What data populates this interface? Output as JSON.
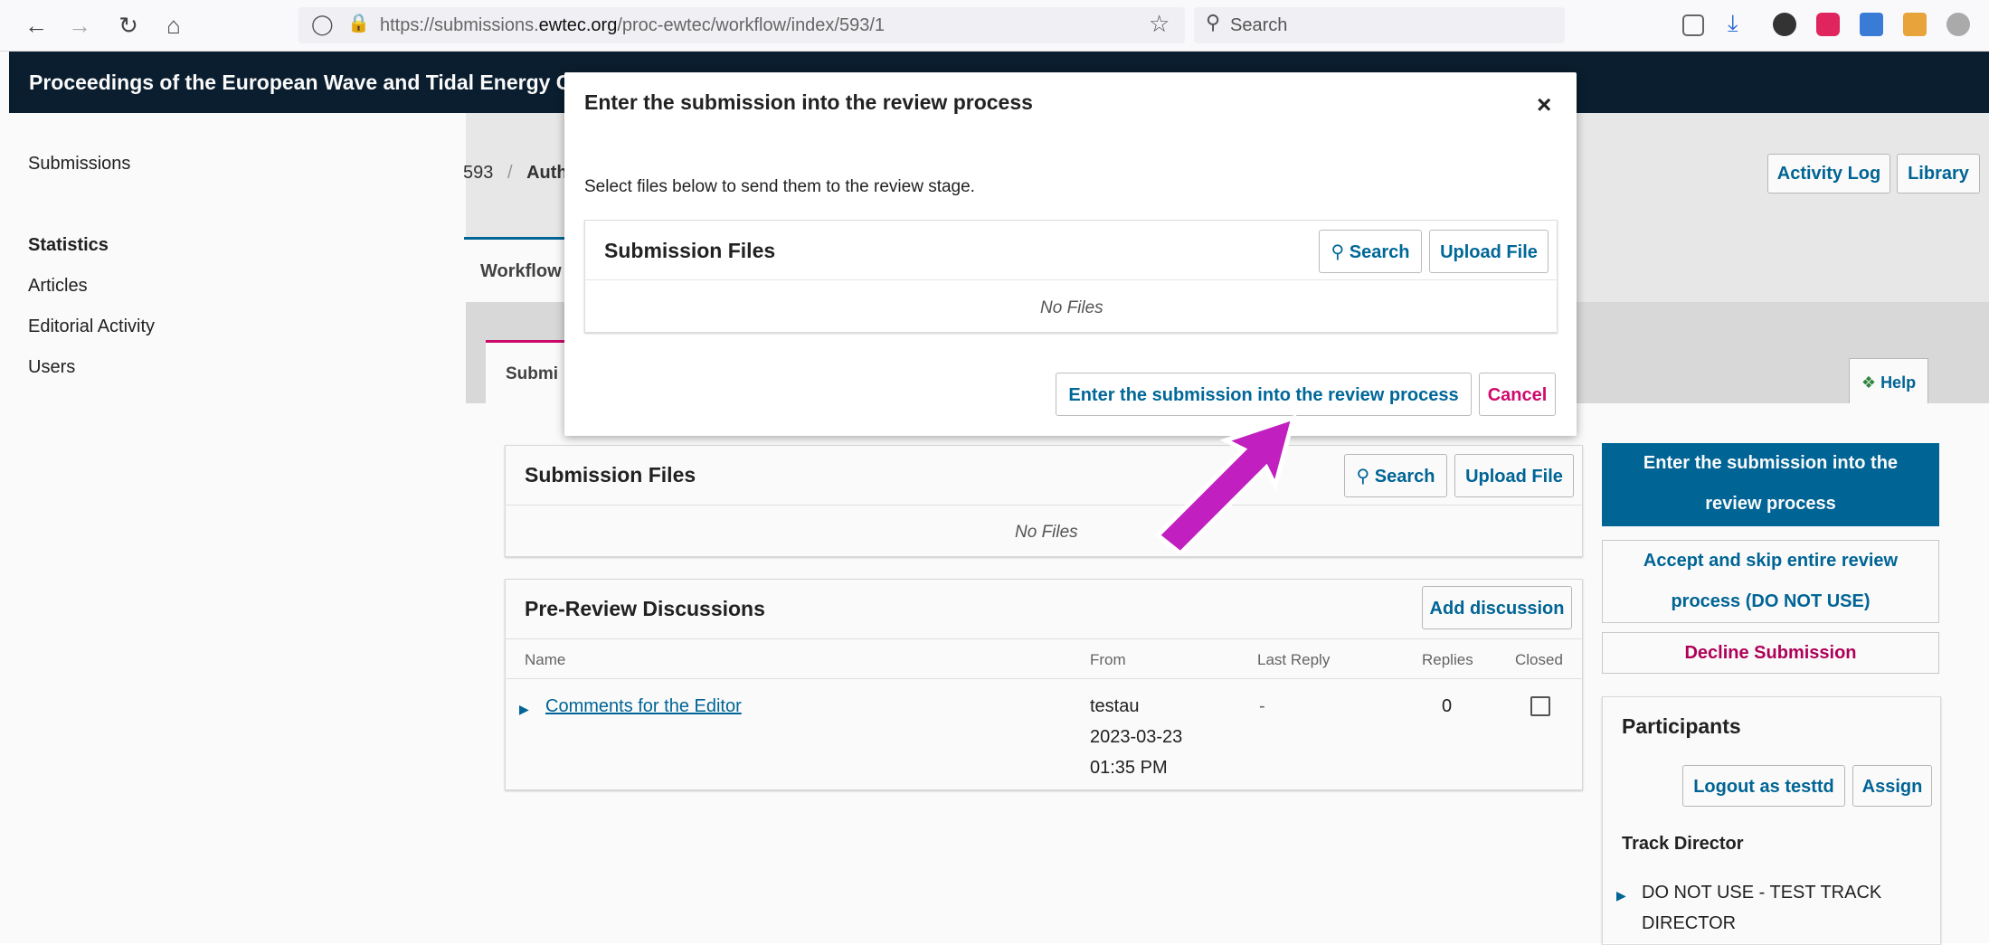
{
  "browser": {
    "url_prefix": "https://submissions.",
    "url_domain": "ewtec.org",
    "url_path": "/proc-ewtec/workflow/index/593/1",
    "search_placeholder": "Search"
  },
  "site": {
    "title": "Proceedings of the European Wave and Tidal Energy C"
  },
  "left_nav": {
    "submissions": "Submissions",
    "statistics": "Statistics",
    "articles": "Articles",
    "editorial_activity": "Editorial Activity",
    "users": "Users"
  },
  "header": {
    "breadcrumb_id": "593",
    "breadcrumb_sep": "/",
    "breadcrumb_author": "Auth",
    "activity_log": "Activity Log",
    "library": "Library"
  },
  "tabs": {
    "workflow": "Workflow",
    "submission": "Submi",
    "help": "Help"
  },
  "submission_files": {
    "title": "Submission Files",
    "search": "Search",
    "upload": "Upload File",
    "empty": "No Files"
  },
  "discussions": {
    "title": "Pre-Review Discussions",
    "add": "Add discussion",
    "columns": [
      "Name",
      "From",
      "Last Reply",
      "Replies",
      "Closed"
    ],
    "rows": [
      {
        "name": "Comments for the Editor",
        "from_user": "testau",
        "from_date": "2023-03-23",
        "from_time": "01:35 PM",
        "last_reply": "-",
        "replies": "0"
      }
    ]
  },
  "actions": {
    "primary_line1": "Enter the submission into the",
    "primary_line2": "review process",
    "accept_line1": "Accept and skip entire review",
    "accept_line2": "process (DO NOT USE)",
    "decline": "Decline Submission"
  },
  "participants": {
    "title": "Participants",
    "logout_as": "Logout as testtd",
    "assign": "Assign",
    "group": "Track Director",
    "member_line1": "DO NOT USE - TEST TRACK",
    "member_line2": "DIRECTOR"
  },
  "modal": {
    "title": "Enter the submission into the review process",
    "close": "×",
    "description": "Select files below to send them to the review stage.",
    "files_title": "Submission Files",
    "search": "Search",
    "upload": "Upload File",
    "empty": "No Files",
    "confirm": "Enter the submission into the review process",
    "cancel": "Cancel"
  },
  "colors": {
    "brand_dark": "#0b1f30",
    "link_blue": "#006798",
    "cancel_red": "#d00a6c",
    "arrow_magenta": "#c11fbf"
  }
}
